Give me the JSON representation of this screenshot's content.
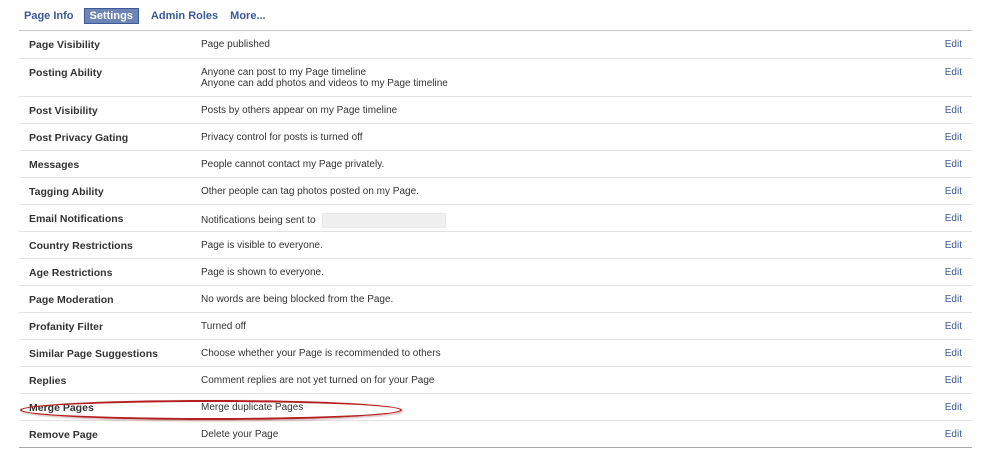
{
  "tabs": [
    {
      "label": "Page Info",
      "active": false
    },
    {
      "label": "Settings",
      "active": true
    },
    {
      "label": "Admin Roles",
      "active": false
    },
    {
      "label": "More...",
      "active": false
    }
  ],
  "settings": [
    {
      "label": "Page Visibility",
      "value": [
        "Page published"
      ],
      "edit": "Edit"
    },
    {
      "label": "Posting Ability",
      "value": [
        "Anyone can post to my Page timeline",
        "Anyone can add photos and videos to my Page timeline"
      ],
      "edit": "Edit"
    },
    {
      "label": "Post Visibility",
      "value": [
        "Posts by others appear on my Page timeline"
      ],
      "edit": "Edit"
    },
    {
      "label": "Post Privacy Gating",
      "value": [
        "Privacy control for posts is turned off"
      ],
      "edit": "Edit"
    },
    {
      "label": "Messages",
      "value": [
        "People cannot contact my Page privately."
      ],
      "edit": "Edit"
    },
    {
      "label": "Tagging Ability",
      "value": [
        "Other people can tag photos posted on my Page."
      ],
      "edit": "Edit"
    },
    {
      "label": "Email Notifications",
      "value": [
        "Notifications being sent to"
      ],
      "edit": "Edit"
    },
    {
      "label": "Country Restrictions",
      "value": [
        "Page is visible to everyone."
      ],
      "edit": "Edit"
    },
    {
      "label": "Age Restrictions",
      "value": [
        "Page is shown to everyone."
      ],
      "edit": "Edit"
    },
    {
      "label": "Page Moderation",
      "value": [
        "No words are being blocked from the Page."
      ],
      "edit": "Edit"
    },
    {
      "label": "Profanity Filter",
      "value": [
        "Turned off"
      ],
      "edit": "Edit"
    },
    {
      "label": "Similar Page Suggestions",
      "value": [
        "Choose whether your Page is recommended to others"
      ],
      "edit": "Edit"
    },
    {
      "label": "Replies",
      "value": [
        "Comment replies are not yet turned on for your Page"
      ],
      "edit": "Edit"
    },
    {
      "label": "Merge Pages",
      "value": [
        "Merge duplicate Pages"
      ],
      "edit": "Edit"
    },
    {
      "label": "Remove Page",
      "value": [
        "Delete your Page"
      ],
      "edit": "Edit"
    }
  ],
  "colors": {
    "link": "#3b5998",
    "active_tab": "#6d84b4",
    "highlight": "#b41e1e"
  }
}
